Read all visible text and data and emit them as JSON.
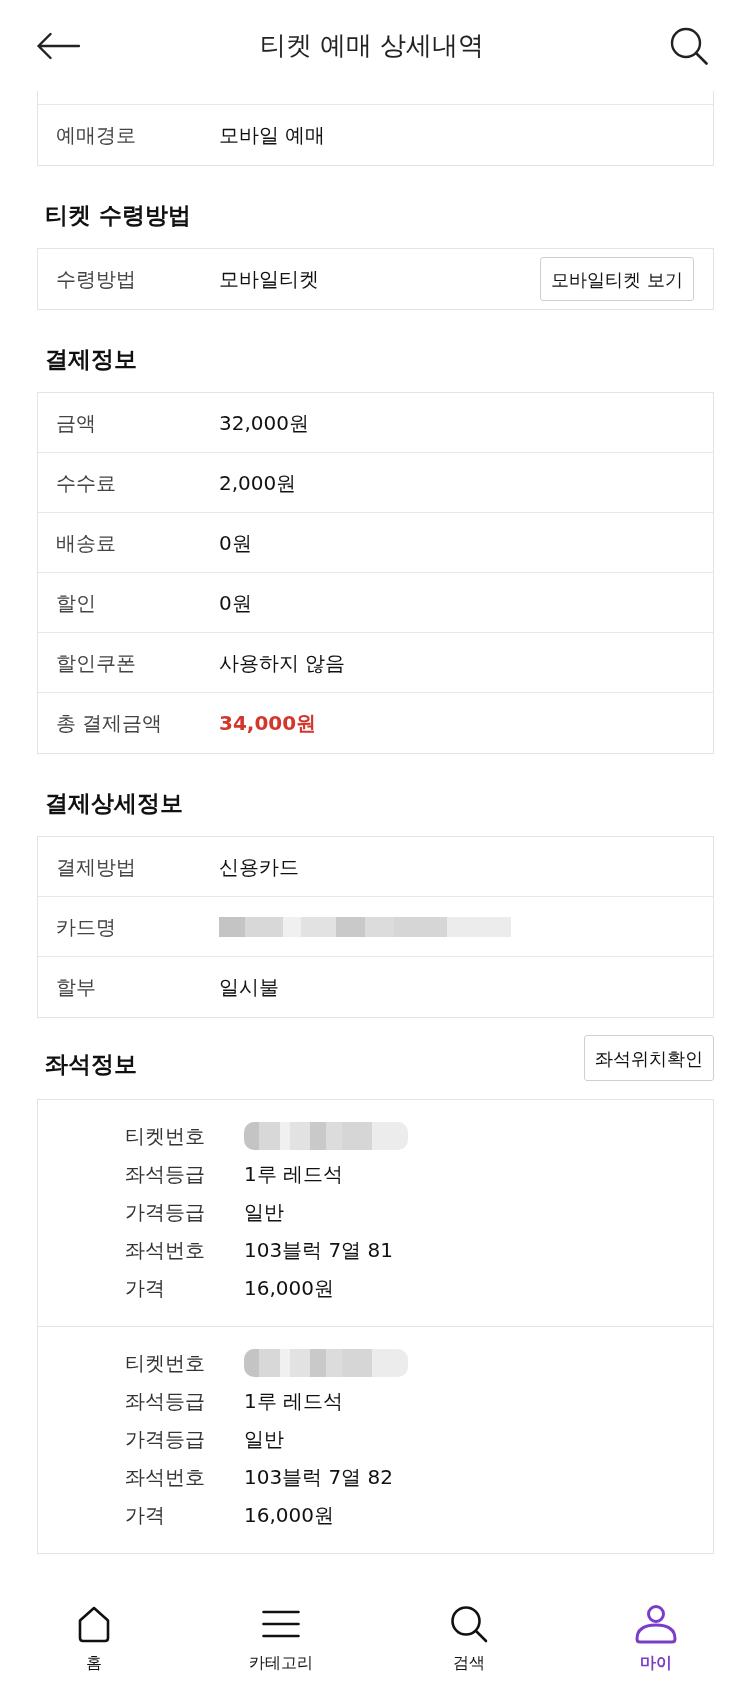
{
  "header": {
    "title": "티켓 예매 상세내역"
  },
  "booking_card": {
    "rows": [
      {
        "kind": "text",
        "label": "예매경로",
        "value": "모바일 예매"
      }
    ]
  },
  "sections": [
    {
      "title": "티켓 수령방법",
      "rows": [
        {
          "kind": "text",
          "label": "수령방법",
          "value": "모바일티켓",
          "button": "모바일티켓 보기"
        }
      ]
    },
    {
      "title": "결제정보",
      "rows": [
        {
          "kind": "text",
          "label": "금액",
          "value": "32,000원"
        },
        {
          "kind": "text",
          "label": "수수료",
          "value": "2,000원"
        },
        {
          "kind": "text",
          "label": "배송료",
          "value": "0원"
        },
        {
          "kind": "text",
          "label": "할인",
          "value": "0원"
        },
        {
          "kind": "text",
          "label": "할인쿠폰",
          "value": "사용하지 않음"
        },
        {
          "kind": "total",
          "label": "총 결제금액",
          "value": "34,000원"
        }
      ]
    },
    {
      "title": "결제상세정보",
      "rows": [
        {
          "kind": "text",
          "label": "결제방법",
          "value": "신용카드"
        },
        {
          "kind": "masked",
          "label": "카드명"
        },
        {
          "kind": "text",
          "label": "할부",
          "value": "일시불"
        }
      ]
    }
  ],
  "seat_info": {
    "title": "좌석정보",
    "button": "좌석위치확인",
    "tickets": [
      {
        "fields": [
          {
            "kind": "masked",
            "label": "티켓번호"
          },
          {
            "kind": "text",
            "label": "좌석등급",
            "value": "1루 레드석"
          },
          {
            "kind": "text",
            "label": "가격등급",
            "value": "일반"
          },
          {
            "kind": "text",
            "label": "좌석번호",
            "value": "103블럭 7열 81"
          },
          {
            "kind": "text",
            "label": "가격",
            "value": "16,000원"
          }
        ]
      },
      {
        "fields": [
          {
            "kind": "masked",
            "label": "티켓번호"
          },
          {
            "kind": "text",
            "label": "좌석등급",
            "value": "1루 레드석"
          },
          {
            "kind": "text",
            "label": "가격등급",
            "value": "일반"
          },
          {
            "kind": "text",
            "label": "좌석번호",
            "value": "103블럭 7열 82"
          },
          {
            "kind": "text",
            "label": "가격",
            "value": "16,000원"
          }
        ]
      }
    ]
  },
  "bottom_nav": [
    {
      "label": "홈",
      "selected": false
    },
    {
      "label": "카테고리",
      "selected": false
    },
    {
      "label": "검색",
      "selected": false
    },
    {
      "label": "마이",
      "selected": true
    }
  ]
}
